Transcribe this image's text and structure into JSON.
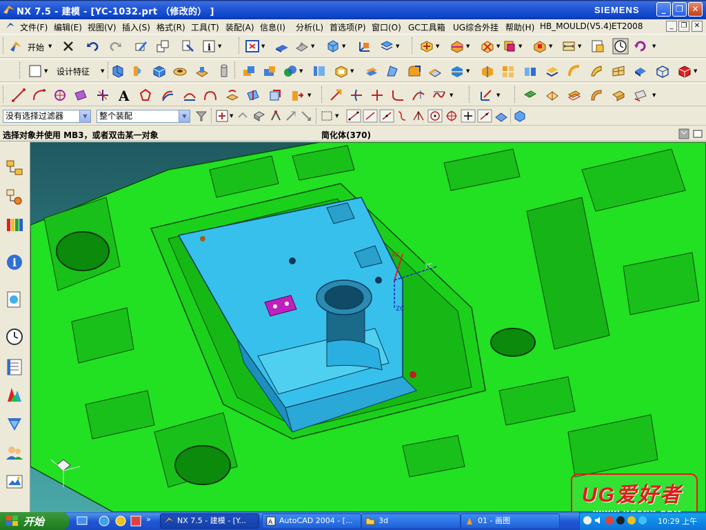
{
  "window": {
    "title": "NX 7.5 - 建模 - [YC-1032.prt （修改的） ]",
    "brand": "SIEMENS"
  },
  "menubar": {
    "items": [
      "文件(F)",
      "编辑(E)",
      "视图(V)",
      "插入(S)",
      "格式(R)",
      "工具(T)",
      "装配(A)",
      "信息(I)",
      "分析(L)",
      "首选项(P)",
      "窗口(O)",
      "GC工具箱",
      "UG综合外挂",
      "帮助(H)",
      "HB_MOULD(V5.4)",
      "ET2008"
    ]
  },
  "toolbar1": {
    "start_label": "开始"
  },
  "toolbar2": {
    "design_feature_label": "设计特征"
  },
  "selection": {
    "filter_value": "没有选择过滤器",
    "scope_value": "整个装配"
  },
  "status": {
    "prompt": "选择对象并使用 MB3，或者双击某一对象",
    "info": "简化体(370)"
  },
  "viewport": {
    "axis_xc": "XC",
    "axis_yc": "YC",
    "axis_zc": "ZC",
    "colors": {
      "mold_base": "#22e022",
      "insert": "#38c0ec",
      "highlight": "#c020c0",
      "background_top": "#1e5a60",
      "background_bottom": "#4aa8a8"
    }
  },
  "taskbar": {
    "start_label": "开始",
    "tasks": [
      "NX 7.5 - 建模 - [Y...",
      "AutoCAD 2004 - [...",
      "3d",
      "01 - 画图"
    ],
    "clock": "10:29 上午"
  },
  "watermark": {
    "title": "UG爱好者",
    "url": "WWW.UGSNX.COM"
  }
}
